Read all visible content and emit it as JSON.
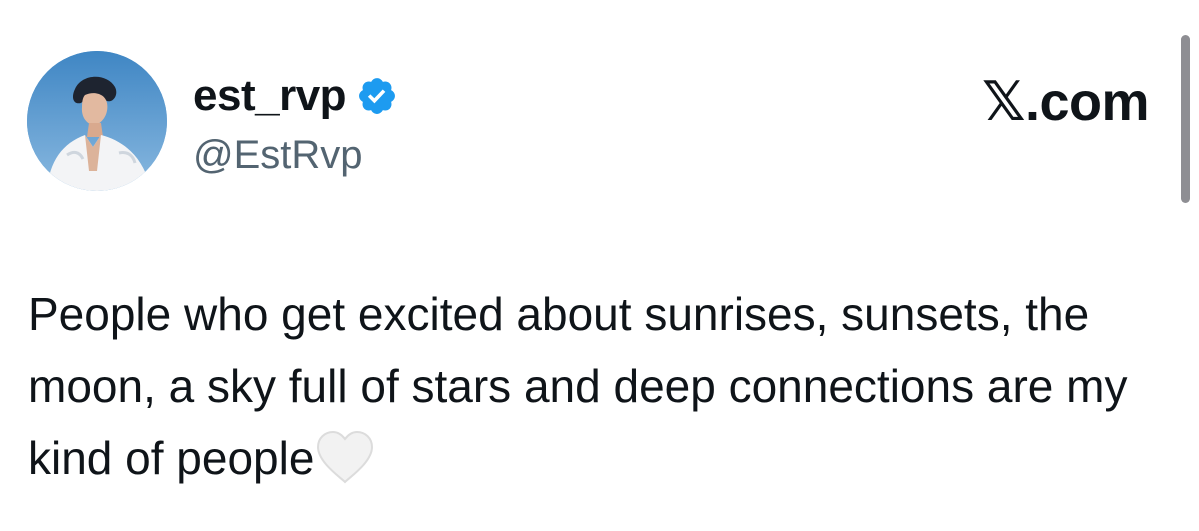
{
  "tweet": {
    "author": {
      "display_name": "est_rvp",
      "handle": "@EstRvp",
      "verified": true,
      "verified_color": "#1d9bf0",
      "avatar_icon": "profile-photo"
    },
    "brand": "𝕏.com",
    "text": "People who get excited about sunrises, sunsets, the moon, a sky full of stars and deep connections are my kind of people",
    "emoji": "white-heart-icon"
  },
  "colors": {
    "text": "#0f1419",
    "secondary": "#536471",
    "background": "#ffffff"
  }
}
